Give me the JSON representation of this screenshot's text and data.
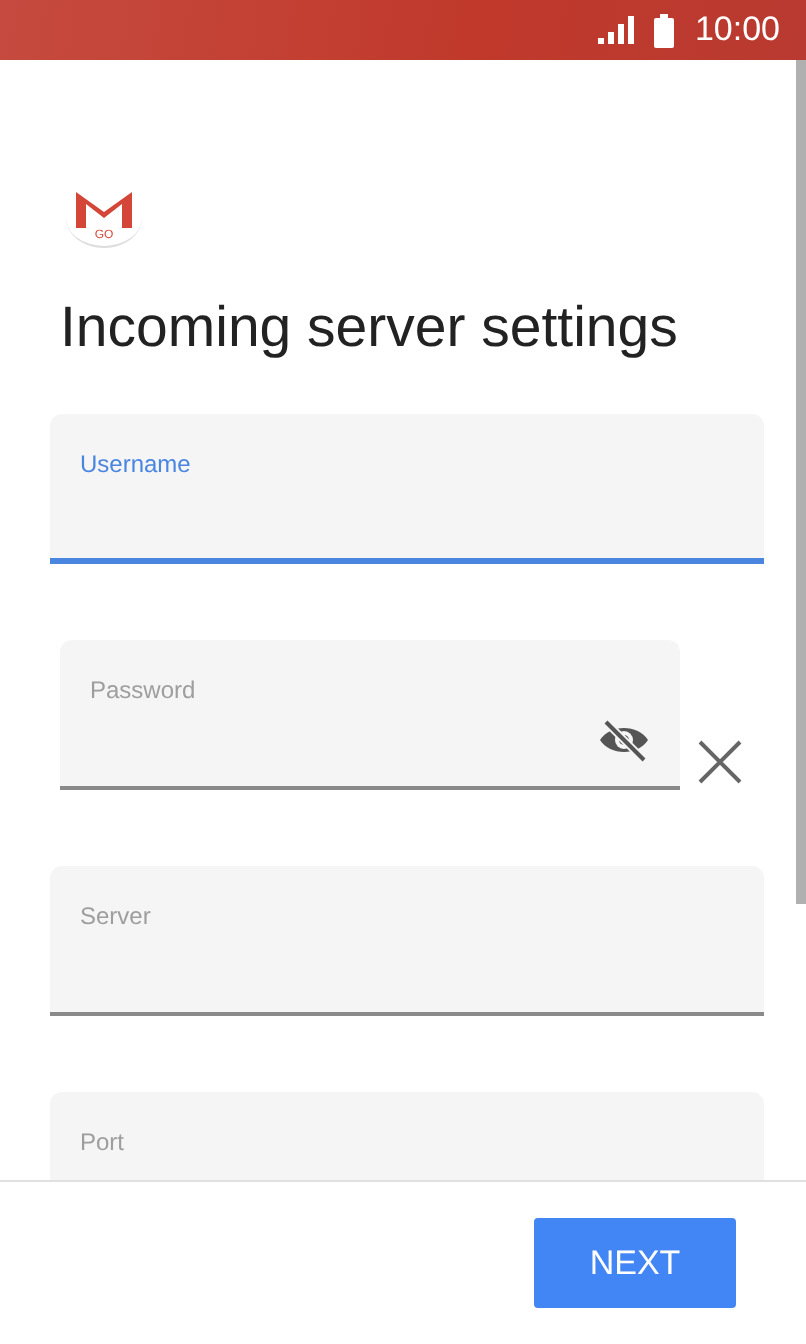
{
  "status_bar": {
    "time": "10:00"
  },
  "logo": {
    "badge": "GO"
  },
  "title": "Incoming server settings",
  "fields": [
    {
      "kind": "text",
      "placeholder": "Username",
      "focused": true
    },
    {
      "kind": "password",
      "placeholder": "Password",
      "focused": false
    },
    {
      "kind": "text",
      "placeholder": "Server",
      "focused": false
    },
    {
      "kind": "text",
      "placeholder": "Port",
      "focused": false
    }
  ],
  "buttons": [
    "NEXT"
  ]
}
